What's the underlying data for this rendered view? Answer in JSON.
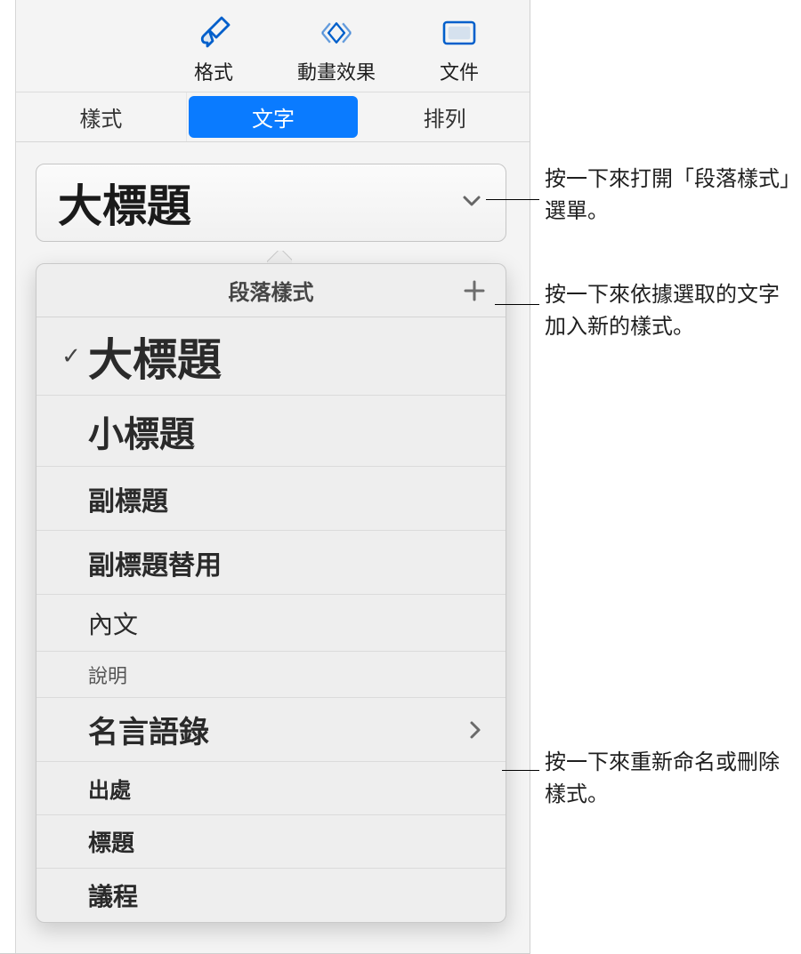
{
  "toolbar": {
    "format": "格式",
    "animation": "動畫效果",
    "document": "文件"
  },
  "tabs": {
    "style": "樣式",
    "text": "文字",
    "arrange": "排列"
  },
  "style_button": {
    "current": "大標題"
  },
  "popover": {
    "title": "段落樣式",
    "items": [
      {
        "label": "大標題",
        "level": "big-title",
        "checked": true
      },
      {
        "label": "小標題",
        "level": "small-title"
      },
      {
        "label": "副標題",
        "level": "subtitle"
      },
      {
        "label": "副標題替用",
        "level": "subtitle-alt"
      },
      {
        "label": "內文",
        "level": "body"
      },
      {
        "label": "說明",
        "level": "caption"
      },
      {
        "label": "名言語錄",
        "level": "quote",
        "arrow": true
      },
      {
        "label": "出處",
        "level": "source"
      },
      {
        "label": "標題",
        "level": "heading"
      },
      {
        "label": "議程",
        "level": "agenda"
      }
    ]
  },
  "callouts": {
    "open_menu": "按一下來打開「段落樣式」選單。",
    "add_style": "按一下來依據選取的文字加入新的樣式。",
    "rename_delete": "按一下來重新命名或刪除樣式。"
  }
}
